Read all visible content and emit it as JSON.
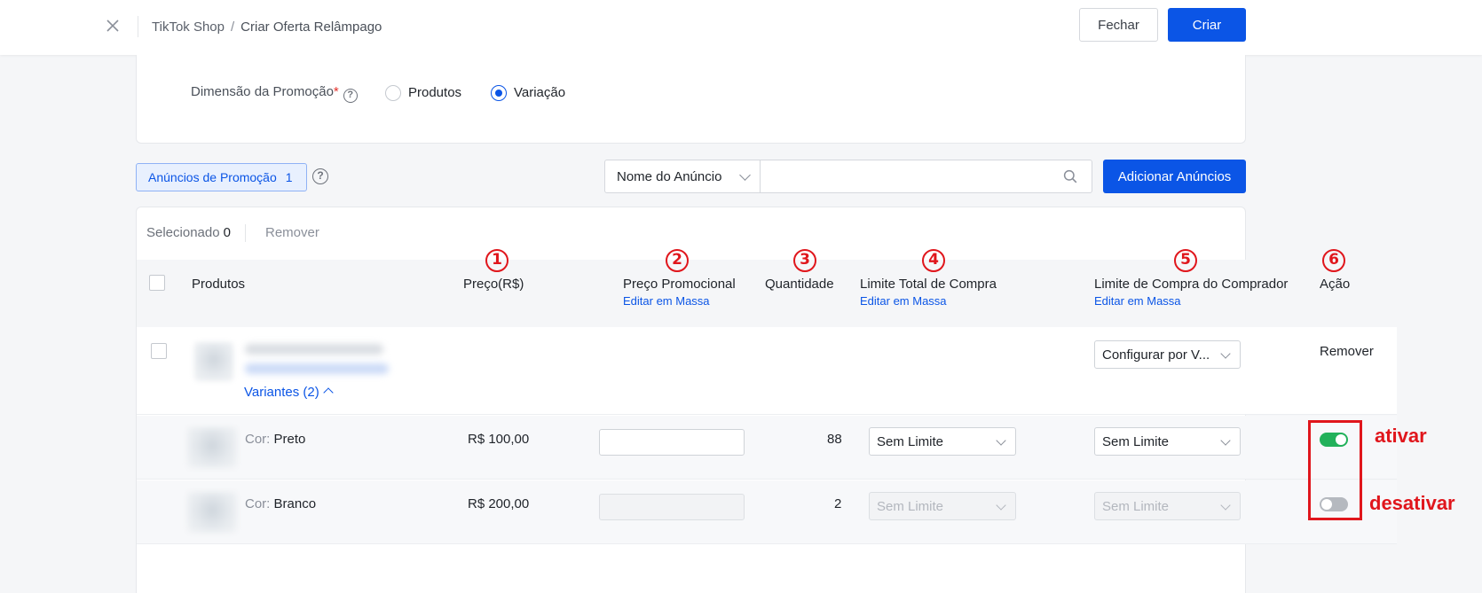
{
  "header": {
    "breadcrumb_root": "TikTok Shop",
    "breadcrumb_sep": "/",
    "breadcrumb_current": "Criar Oferta Relâmpago",
    "close_label": "Fechar",
    "create_label": "Criar"
  },
  "dimension": {
    "label": "Dimensão da Promoção",
    "required_mark": "*",
    "help": "?",
    "options": [
      "Produtos",
      "Variação"
    ],
    "selected": "Variação"
  },
  "toolbar": {
    "tag_label": "Anúncios de Promoção",
    "tag_count": "1",
    "help": "?",
    "search_field": "Nome do Anúncio",
    "search_placeholder": "",
    "add_label": "Adicionar Anúncios"
  },
  "selection": {
    "label": "Selecionado",
    "count": "0",
    "remove_label": "Remover"
  },
  "table": {
    "columns": [
      {
        "label": "Produtos",
        "sub": ""
      },
      {
        "label": "Preço(R$)",
        "sub": ""
      },
      {
        "label": "Preço Promocional",
        "sub": "Editar em Massa"
      },
      {
        "label": "Quantidade",
        "sub": ""
      },
      {
        "label": "Limite Total de Compra",
        "sub": "Editar em Massa"
      },
      {
        "label": "Limite de Compra do Comprador",
        "sub": "Editar em Massa"
      },
      {
        "label": "Ação",
        "sub": ""
      }
    ],
    "annotation_numbers": [
      "1",
      "2",
      "3",
      "4",
      "5",
      "6"
    ],
    "product": {
      "variants_label": "Variantes (2)",
      "buyer_limit": "Configurar por V...",
      "action": "Remover"
    },
    "variants": [
      {
        "attr": "Cor:",
        "value": "Preto",
        "price": "R$ 100,00",
        "quantity": "88",
        "total_limit": "Sem Limite",
        "buyer_limit": "Sem Limite",
        "enabled": true
      },
      {
        "attr": "Cor:",
        "value": "Branco",
        "price": "R$ 200,00",
        "quantity": "2",
        "total_limit": "Sem Limite",
        "buyer_limit": "Sem Limite",
        "enabled": false
      }
    ]
  },
  "annotations": {
    "on_label": "ativar",
    "off_label": "desativar",
    "color": "#e0161c"
  },
  "colors": {
    "primary": "#0b55e6",
    "toggle_on": "#22b15a",
    "toggle_off": "#b5b9bf"
  }
}
